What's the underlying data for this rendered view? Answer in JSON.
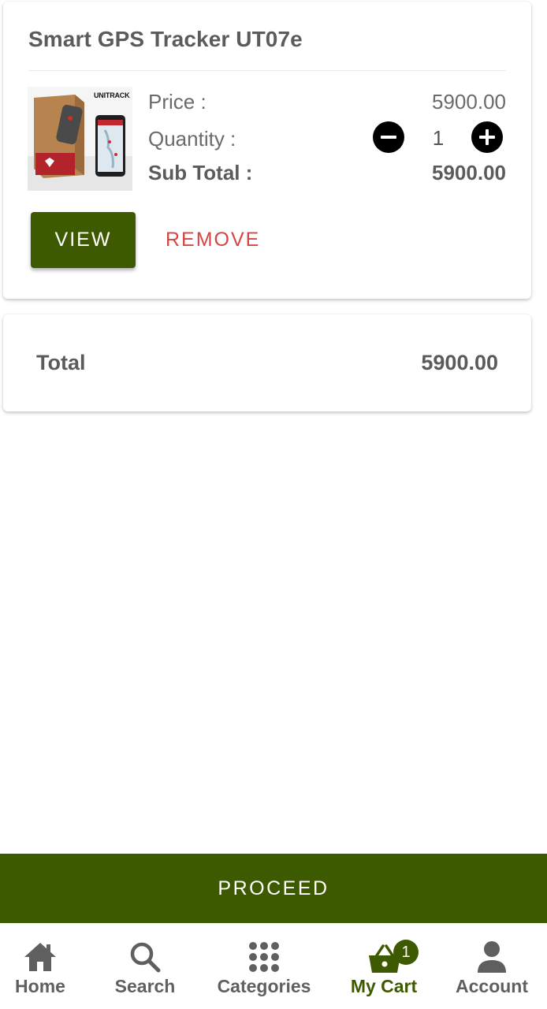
{
  "cart_item": {
    "title": "Smart GPS Tracker UT07e",
    "image_brand": "UNITRACK",
    "price_label": "Price :",
    "price_value": "5900.00",
    "quantity_label": "Quantity  :",
    "quantity_value": "1",
    "subtotal_label": "Sub Total :",
    "subtotal_value": "5900.00",
    "view_label": "VIEW",
    "remove_label": "REMOVE"
  },
  "summary": {
    "total_label": "Total",
    "total_value": "5900.00"
  },
  "proceed_label": "PROCEED",
  "nav": {
    "home": "Home",
    "search": "Search",
    "categories": "Categories",
    "cart": "My Cart",
    "cart_badge": "1",
    "account": "Account"
  },
  "colors": {
    "brand_green": "#3d5a00",
    "remove_red": "#d64545",
    "text_gray": "#5f5f5f"
  },
  "icons": [
    "minus-icon",
    "plus-icon",
    "home-icon",
    "search-icon",
    "grid-icon",
    "basket-icon",
    "person-icon"
  ]
}
